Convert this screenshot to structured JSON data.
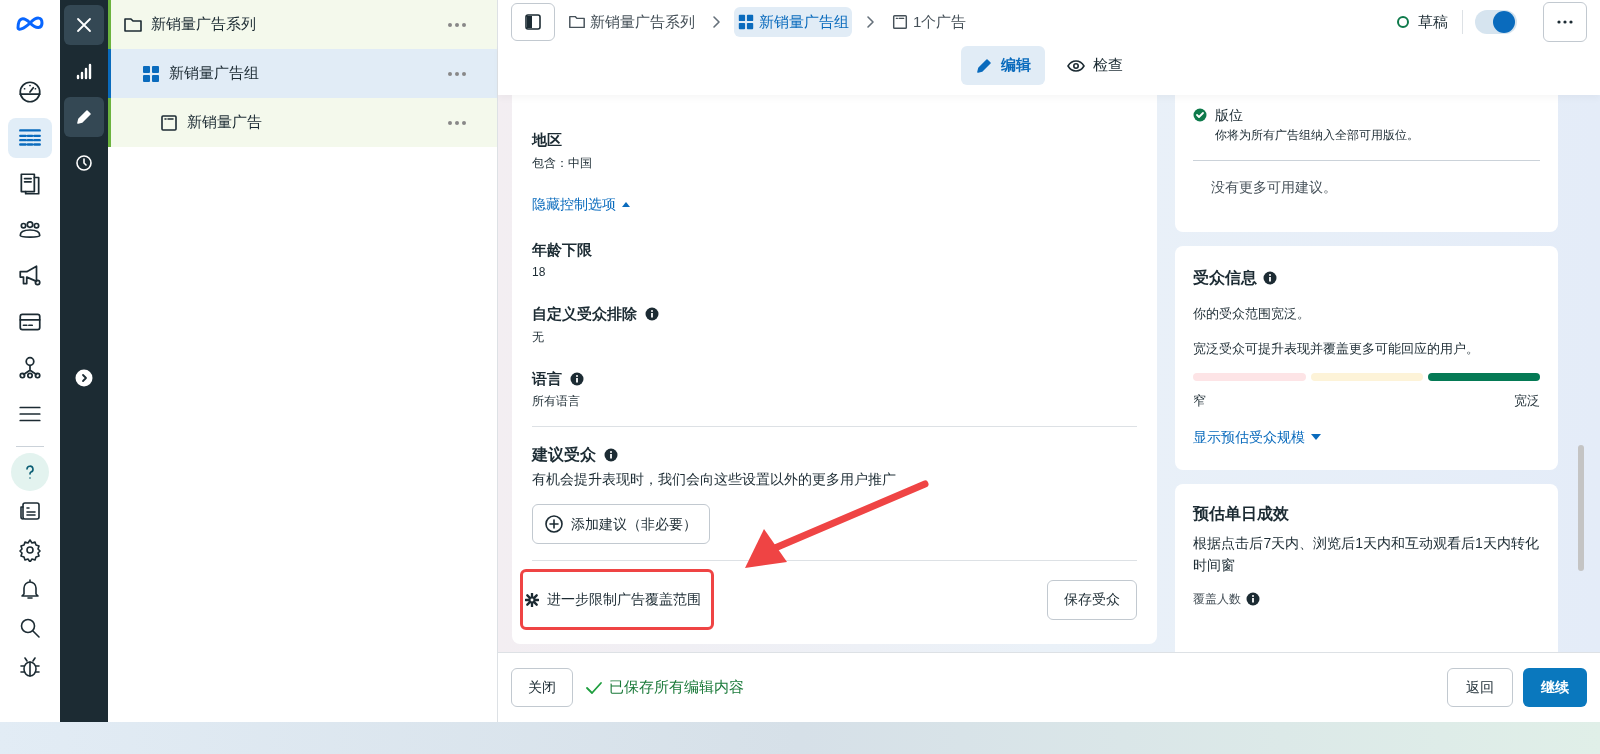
{
  "nav_top": [
    {
      "selected": false
    },
    {
      "selected": true
    },
    {
      "selected": false
    },
    {
      "selected": false
    },
    {
      "selected": false
    },
    {
      "selected": false
    },
    {
      "selected": false
    },
    {
      "selected": false
    }
  ],
  "nav_bottom": [
    {
      "selected": true
    },
    {
      "selected": false
    },
    {
      "selected": false
    },
    {
      "selected": false
    },
    {
      "selected": false
    },
    {
      "selected": false
    }
  ],
  "rail": [
    {
      "selected": false
    },
    {
      "selected": true
    },
    {
      "selected": false
    }
  ],
  "tree": [
    {
      "label": "新销量广告系列",
      "selected": false,
      "children": [
        {
          "label": "新销量广告组",
          "selected": true,
          "children": [
            {
              "label": "新销量广告",
              "selected": false
            }
          ]
        }
      ]
    }
  ],
  "breadcrumbs": [
    {
      "label": "新销量广告系列",
      "selected": false
    },
    {
      "label": "新销量广告组",
      "selected": true
    },
    {
      "label": "1个广告",
      "selected": false
    }
  ],
  "status": {
    "label": "草稿"
  },
  "toggle": {
    "on": true
  },
  "tabs": [
    {
      "label": "编辑",
      "selected": true
    },
    {
      "label": "检查",
      "selected": false
    }
  ],
  "audience": {
    "fields": [
      {
        "title": "地区",
        "value": "包含：中国",
        "info": false
      }
    ],
    "toggle_link": "隐藏控制选项",
    "controls": [
      {
        "title": "年龄下限",
        "value": "18",
        "info": false
      },
      {
        "title": "自定义受众排除",
        "value": "无",
        "info": true
      },
      {
        "title": "语言",
        "value": "所有语言",
        "info": true
      }
    ],
    "suggested": {
      "title": "建议受众",
      "info": true,
      "description": "有机会提升表现时，我们会向这些设置以外的更多用户推广",
      "button": "添加建议（非必要）"
    },
    "restrict": "进一步限制广告覆盖范围",
    "save_button": "保存受众"
  },
  "placement": {
    "title": "版位",
    "description": "你将为所有广告组纳入全部可用版位。",
    "done": true,
    "note": "没有更多可用建议。"
  },
  "audience_info": {
    "title": "受众信息",
    "info": true,
    "lines": [
      "你的受众范围宽泛。",
      "宽泛受众可提升表现并覆盖更多可能回应的用户。"
    ],
    "segments": [
      {
        "selected": false
      },
      {
        "selected": false
      },
      {
        "selected": true
      }
    ],
    "low": "窄",
    "high": "宽泛",
    "link": "显示预估受众规模"
  },
  "estimate": {
    "title": "预估单日成效",
    "description": "根据点击后7天内、浏览后1天内和互动观看后1天内转化时间窗",
    "metric": "覆盖人数",
    "metric_info": true
  },
  "footer": {
    "close": "关闭",
    "saved": "已保存所有编辑内容",
    "back": "返回",
    "continue": "继续"
  }
}
